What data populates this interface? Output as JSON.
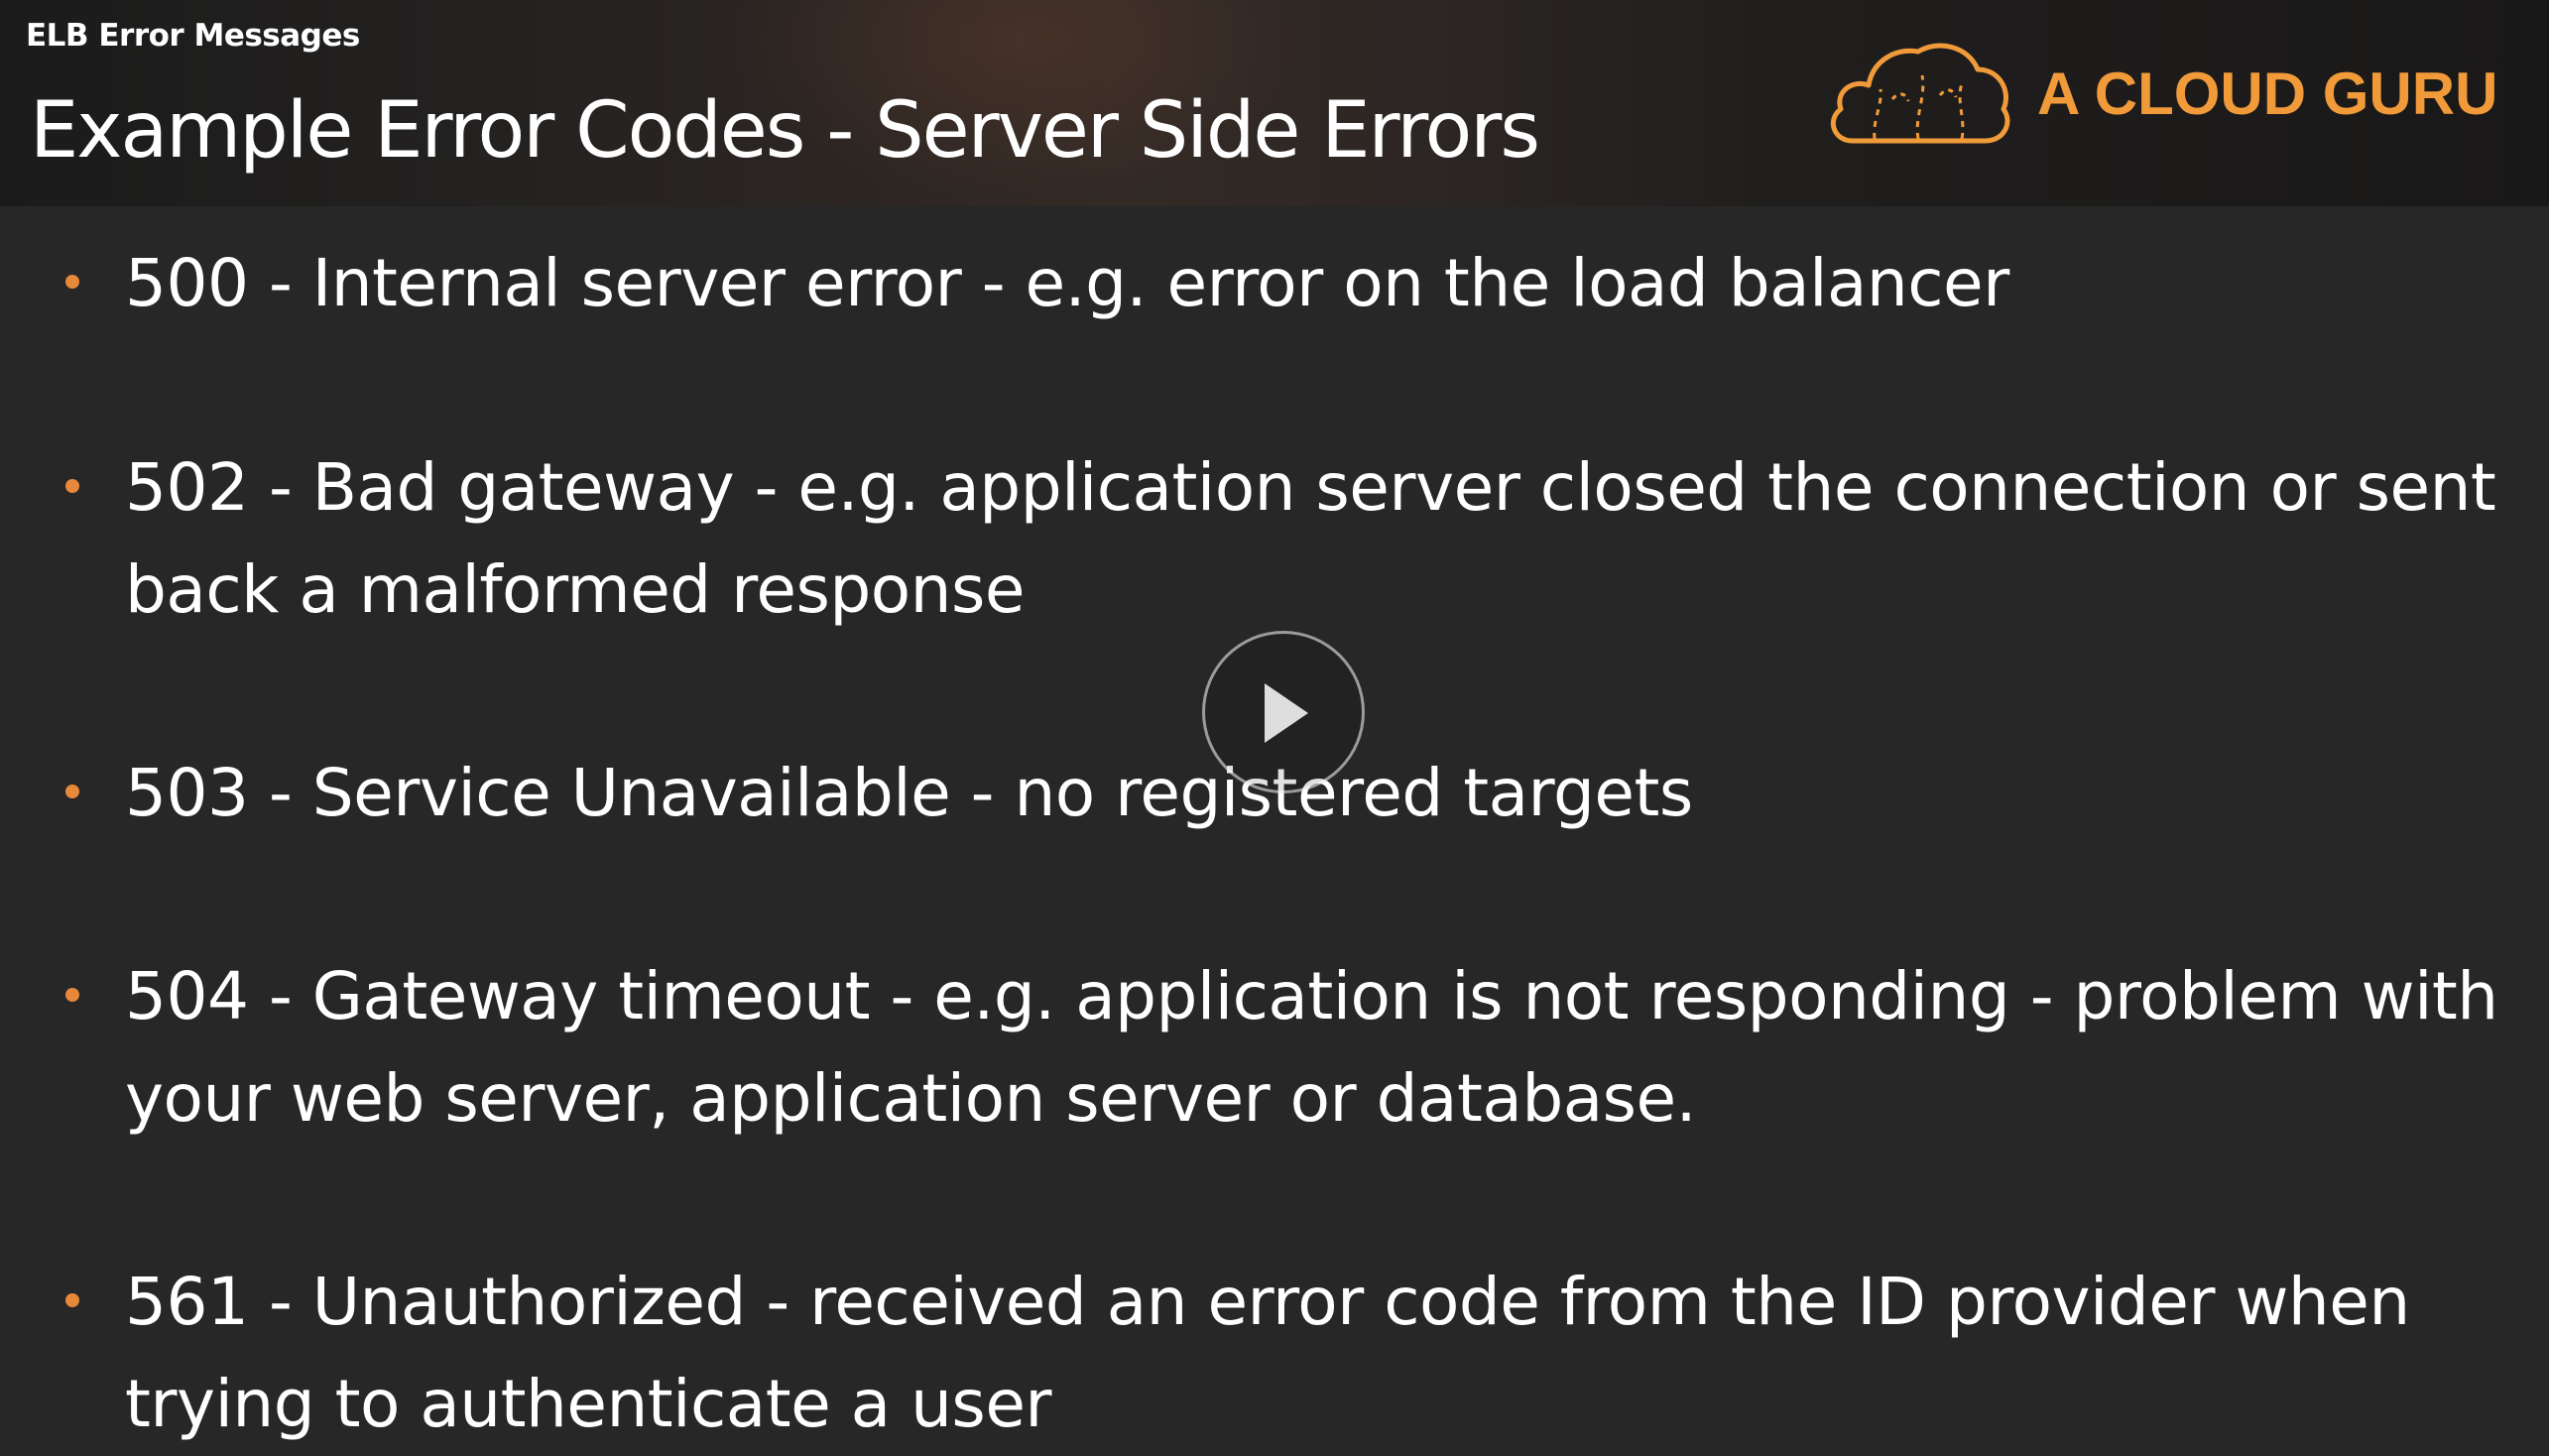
{
  "video": {
    "title": "ELB Error Messages"
  },
  "slide": {
    "title": "Example Error Codes - Server Side Errors",
    "brand": {
      "name": "A CLOUD GURU",
      "color": "#f19a3a"
    },
    "bullet_color": "#e8883a",
    "bullets": [
      {
        "text": "500  - Internal server error - e.g. error on the load balancer"
      },
      {
        "text": "502 - Bad gateway - e.g. application server closed the connection or sent back a malformed response"
      },
      {
        "text": "503 - Service Unavailable - no registered targets"
      },
      {
        "text": "504 - Gateway timeout - e.g. application is not responding - problem with your web server, application server or database."
      },
      {
        "text": "561 - Unauthorized - received an error code from the ID provider when trying to authenticate a user"
      }
    ]
  },
  "player": {
    "play_icon": "play-icon"
  }
}
